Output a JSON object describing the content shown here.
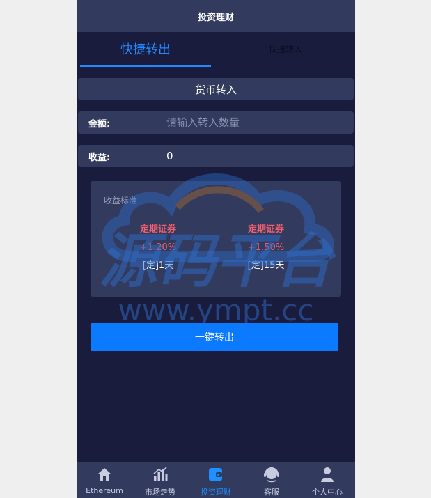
{
  "header": {
    "title": "投资理财"
  },
  "tabs": [
    {
      "label": "快捷转出",
      "active": true
    },
    {
      "label": "快捷转入",
      "active": false
    }
  ],
  "section": {
    "title": "货币转入"
  },
  "form": {
    "amount_label": "金额:",
    "amount_placeholder": "请输入转入数量",
    "amount_value": "",
    "income_label": "收益:",
    "income_value": "0"
  },
  "rates": {
    "title": "收益标准",
    "items": [
      {
        "name": "定期证券",
        "rate": "+1.20%",
        "term": "[定]1天"
      },
      {
        "name": "定期证券",
        "rate": "+1.50%",
        "term": "[定]15天"
      }
    ]
  },
  "watermark": {
    "text_cn": "源码平台",
    "text_url": "www.ympt.cc"
  },
  "submit": {
    "label": "一键转出"
  },
  "bottom_nav": {
    "items": [
      {
        "label": "Ethereum",
        "icon": "home-icon",
        "active": false
      },
      {
        "label": "市场走势",
        "icon": "bar-chart-icon",
        "active": false
      },
      {
        "label": "投资理财",
        "icon": "wallet-icon",
        "active": true
      },
      {
        "label": "客服",
        "icon": "headset-icon",
        "active": false
      },
      {
        "label": "个人中心",
        "icon": "user-icon",
        "active": false
      }
    ]
  },
  "colors": {
    "background": "#191c3c",
    "panel": "#323a5e",
    "accent": "#0b7aff",
    "tab_active": "#2489ff",
    "rate_red": "#f55f6e"
  }
}
